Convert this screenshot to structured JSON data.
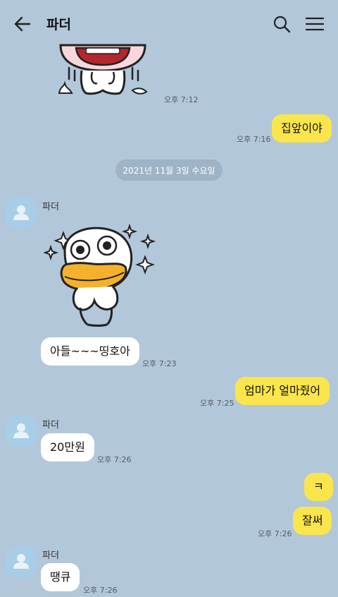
{
  "header": {
    "title": "파더",
    "back_icon": "arrow-left-icon",
    "search_icon": "search-icon",
    "menu_icon": "hamburger-menu-icon"
  },
  "date_divider": "2021년 11월 3일 수요일",
  "messages": [
    {
      "direction": "in",
      "type": "sticker",
      "sticker": "crying-face-sticker",
      "time": "오후 7:12"
    },
    {
      "direction": "out",
      "type": "text",
      "text": "집앞이야",
      "time": "오후 7:16"
    },
    {
      "direction": "in",
      "sender": "파더",
      "type": "sticker",
      "sticker": "surprised-duck-sticker"
    },
    {
      "direction": "in",
      "type": "text",
      "text": "아들~~~띵호아",
      "time": "오후 7:23"
    },
    {
      "direction": "out",
      "type": "text",
      "text": "엄마가 얼마줬어",
      "time": "오후 7:25"
    },
    {
      "direction": "in",
      "sender": "파더",
      "type": "text",
      "text": "20만원",
      "time": "오후 7:26"
    },
    {
      "direction": "out",
      "type": "text",
      "text": "ㅋ"
    },
    {
      "direction": "out",
      "type": "text",
      "text": "잘써",
      "time": "오후 7:26"
    },
    {
      "direction": "in",
      "sender": "파더",
      "type": "text",
      "text": "땡큐",
      "time": "오후 7:26"
    }
  ],
  "colors": {
    "background": "#b2c7da",
    "outgoing_bubble": "#fae54c",
    "incoming_bubble": "#ffffff",
    "avatar": "#a8cde6"
  }
}
